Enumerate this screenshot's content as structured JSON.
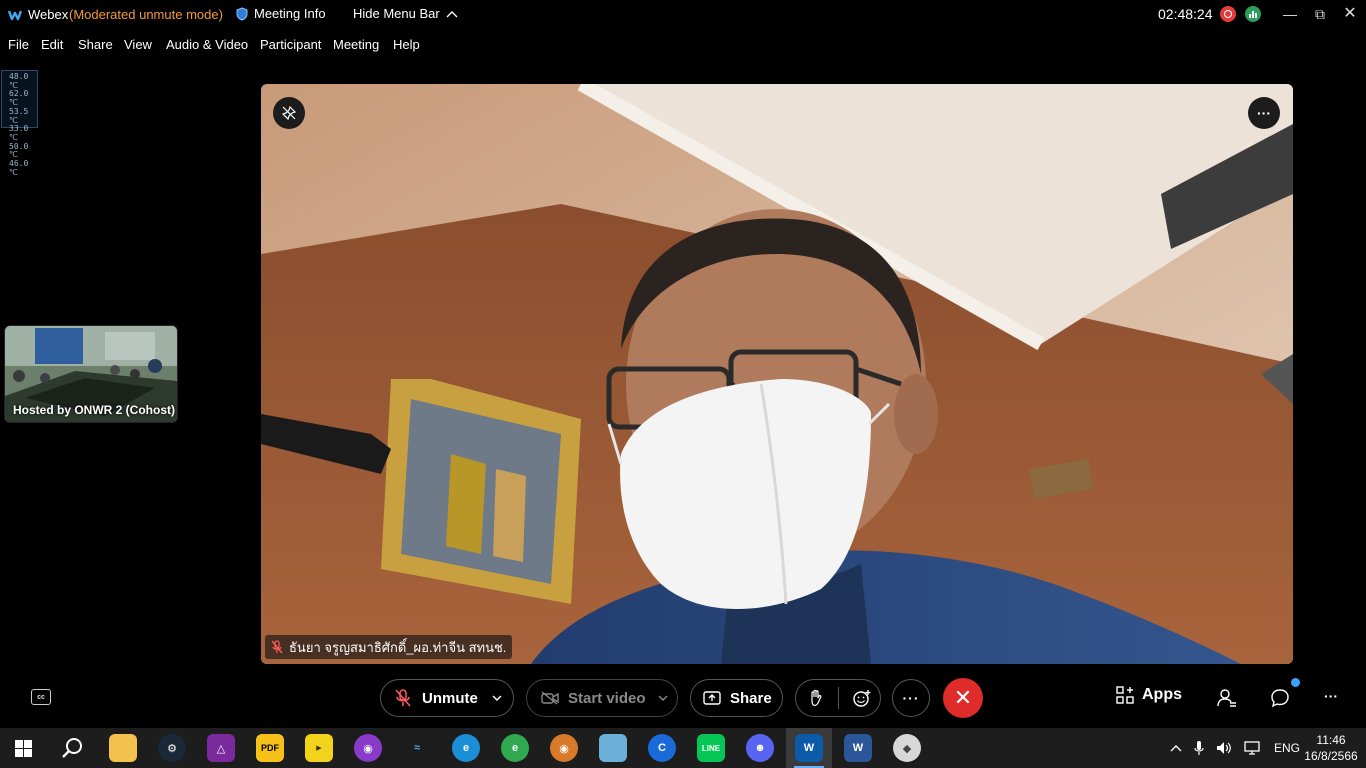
{
  "titlebar": {
    "app_name": "Webex",
    "mode": "(Moderated unmute mode)",
    "meeting_info": "Meeting Info",
    "hide_menu": "Hide Menu Bar",
    "clock": "02:48:24",
    "mode_color": "#f39a3b"
  },
  "menu": {
    "items": [
      "File",
      "Edit",
      "Share",
      "View",
      "Audio & Video",
      "Participant",
      "Meeting",
      "Help"
    ]
  },
  "temps": [
    "48.0 ℃",
    "62.0 ℃",
    "53.5 ℃",
    "33.0 ℃",
    "50.0 ℃",
    "46.0 ℃"
  ],
  "thumbnail": {
    "caption": "Hosted by ONWR 2 (Cohost)"
  },
  "video": {
    "participant_name": "ธันยา จรูญสมาธิศักดิ์_ผอ.ท่าจีน สทนช."
  },
  "controls": {
    "unmute": "Unmute",
    "start_video": "Start video",
    "share": "Share",
    "apps": "Apps",
    "end_color": "#e02b2b"
  },
  "taskbar": {
    "language": "ENG",
    "time": "11:46",
    "date": "16/8/2566"
  }
}
